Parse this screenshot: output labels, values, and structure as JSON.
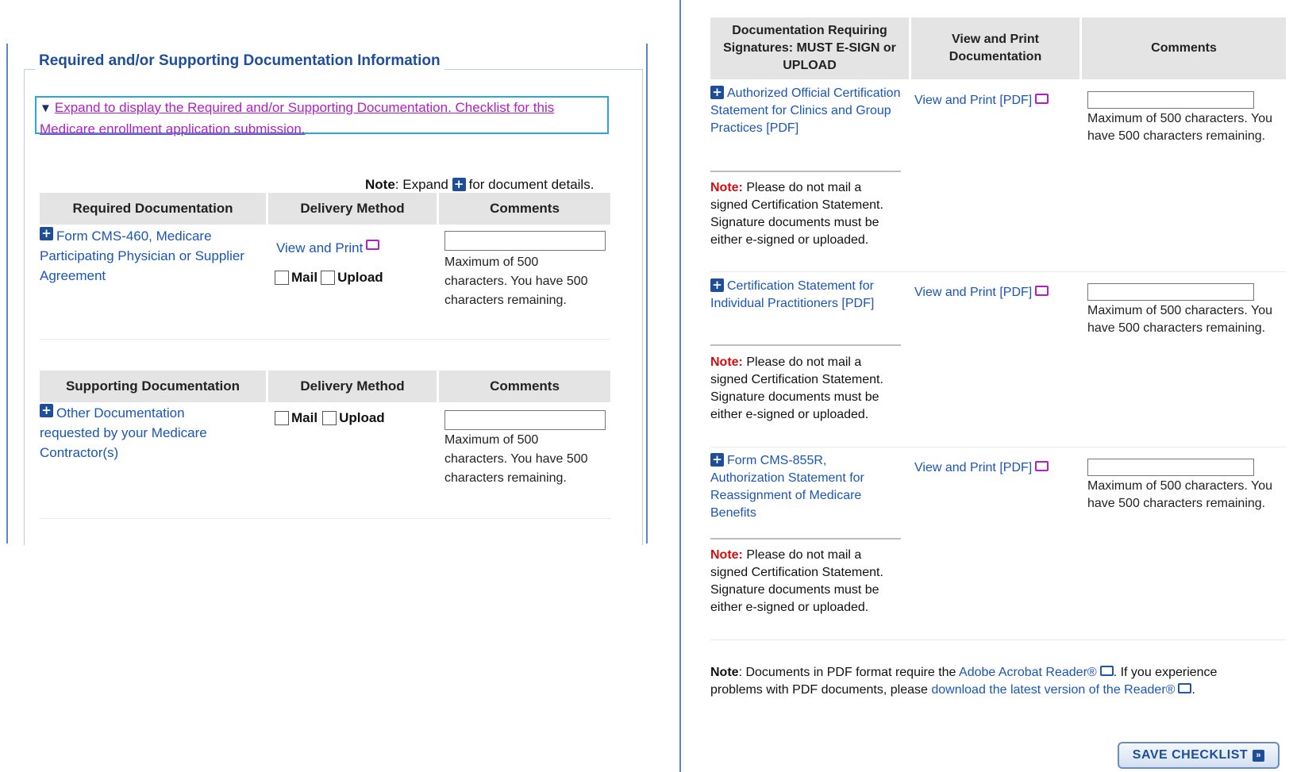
{
  "left": {
    "section_title": "Required and/or Supporting Documentation Information",
    "expand_text": "Expand to display the Required and/or Supporting Documentation. Checklist for this Medicare enrollment application submission.",
    "note_label": "Note",
    "note_pre": ": Expand",
    "note_post": "for document details.",
    "required_table": {
      "headers": [
        "Required Documentation",
        "Delivery Method",
        "Comments"
      ],
      "doc_link": "Form CMS-460, Medicare Participating Physician or Supplier Agreement",
      "view_print": "View and Print",
      "mail_label": "Mail",
      "upload_label": "Upload",
      "comment_hint": "Maximum of 500 characters. You have 500 characters remaining."
    },
    "supporting_table": {
      "headers": [
        "Supporting Documentation",
        "Delivery Method",
        "Comments"
      ],
      "doc_link": "Other Documentation requested by your Medicare Contractor(s)",
      "mail_label": "Mail",
      "upload_label": "Upload",
      "comment_hint": "Maximum of 500 characters. You have 500 characters remaining."
    }
  },
  "right": {
    "headers": [
      "Documentation Requiring Signatures: MUST E-SIGN or UPLOAD",
      "View and Print Documentation",
      "Comments"
    ],
    "rows": [
      {
        "doc_link": "Authorized Official Certification Statement for Clinics and Group Practices [PDF]",
        "view_print": "View and Print [PDF]",
        "comment_hint": "Maximum of 500 characters. You have 500 characters remaining.",
        "note_label": "Note:",
        "note_text": " Please do not mail a signed Certification Statement. Signature documents must be either e-signed or uploaded."
      },
      {
        "doc_link": "Certification Statement for Individual Practitioners [PDF]",
        "view_print": "View and Print [PDF]",
        "comment_hint": "Maximum of 500 characters. You have 500 characters remaining.",
        "note_label": "Note:",
        "note_text": " Please do not mail a signed Certification Statement. Signature documents must be either e-signed or uploaded."
      },
      {
        "doc_link": "Form CMS-855R, Authorization Statement for Reassignment of Medicare Benefits",
        "view_print": "View and Print [PDF]",
        "comment_hint": "Maximum of 500 characters. You have 500 characters remaining.",
        "note_label": "Note:",
        "note_text": " Please do not mail a signed Certification Statement. Signature documents must be either e-signed or uploaded."
      }
    ],
    "footer": {
      "note_label": "Note",
      "text_1": ": Documents in PDF format require the ",
      "link_1": "Adobe Acrobat Reader®",
      "text_2": ". If you experience problems with PDF documents, please ",
      "link_2": "download the latest version of the Reader®",
      "text_3": "."
    },
    "save_button": "SAVE CHECKLIST"
  },
  "colors": {
    "link_blue": "#1a56b8",
    "visited_purple": "#b01fc7",
    "heading_blue": "#1f4e99",
    "note_red": "#d01010",
    "header_gray": "#e4e4e4"
  }
}
